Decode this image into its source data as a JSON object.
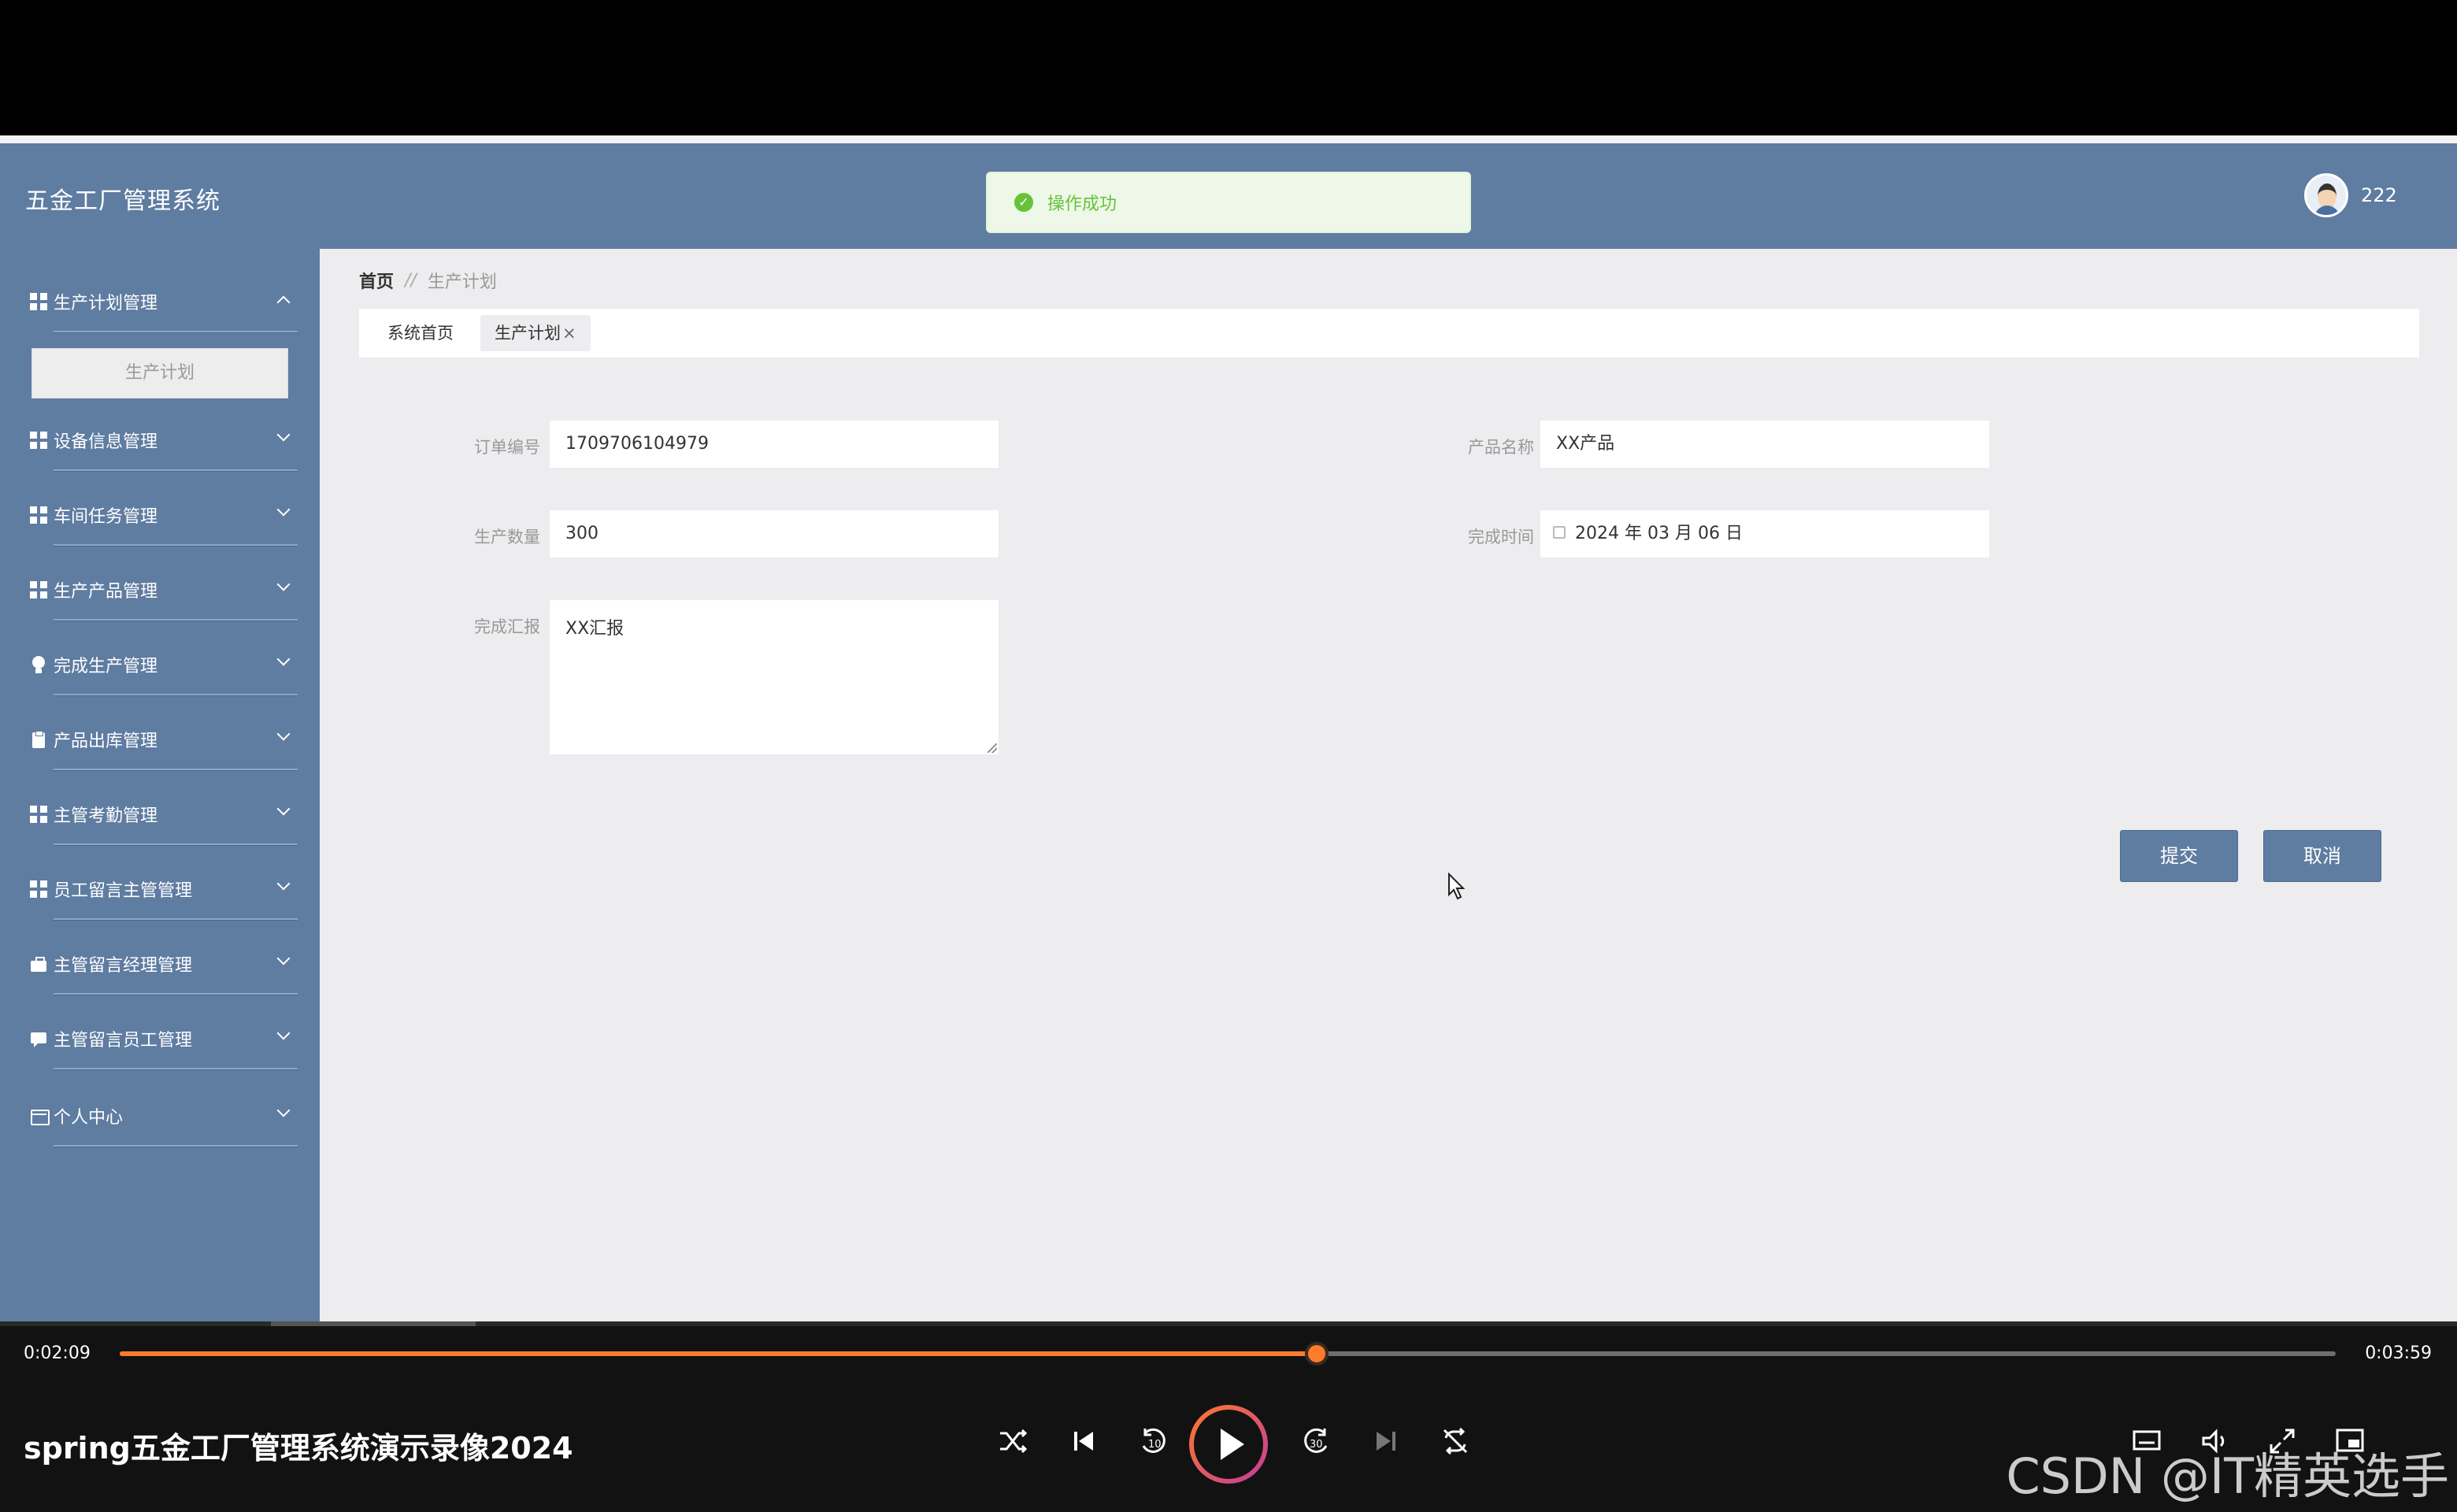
{
  "app": {
    "title": "五金工厂管理系统",
    "toast": "操作成功",
    "username": "222"
  },
  "sidebar": {
    "items": [
      {
        "label": "生产计划管理",
        "icon": "grid-icon",
        "expanded": true
      },
      {
        "label": "设备信息管理",
        "icon": "grid-icon"
      },
      {
        "label": "车间任务管理",
        "icon": "grid-icon"
      },
      {
        "label": "生产产品管理",
        "icon": "grid-icon"
      },
      {
        "label": "完成生产管理",
        "icon": "bulb-icon"
      },
      {
        "label": "产品出库管理",
        "icon": "clipboard-icon"
      },
      {
        "label": "主管考勤管理",
        "icon": "grid-icon"
      },
      {
        "label": "员工留言主管管理",
        "icon": "grid-icon"
      },
      {
        "label": "主管留言经理管理",
        "icon": "briefcase-icon"
      },
      {
        "label": "主管留言员工管理",
        "icon": "chat-icon"
      },
      {
        "label": "个人中心",
        "icon": "card-icon"
      }
    ],
    "submenu_active": "生产计划"
  },
  "breadcrumb": {
    "home": "首页",
    "separator": "//",
    "current": "生产计划"
  },
  "tabs": [
    {
      "label": "系统首页"
    },
    {
      "label": "生产计划",
      "close": "×"
    }
  ],
  "form": {
    "order_no_label": "订单编号",
    "order_no_value": "1709706104979",
    "product_name_label": "产品名称",
    "product_name_value": "XX产品",
    "quantity_label": "生产数量",
    "quantity_value": "300",
    "finish_time_label": "完成时间",
    "finish_time_value": "2024 年 03 月 06 日",
    "report_label": "完成汇报",
    "report_value": "XX汇报",
    "submit_label": "提交",
    "cancel_label": "取消"
  },
  "player": {
    "current_time": "0:02:09",
    "total_time": "0:03:59",
    "progress": 0.54,
    "title": "spring五金工厂管理系统演示录像2024",
    "watermark": "CSDN @IT精英选手"
  },
  "colors": {
    "header_bg": "#5f7ca1",
    "main_bg": "#edecee",
    "success": "#67c23a",
    "progress": "#ff7a2a"
  }
}
